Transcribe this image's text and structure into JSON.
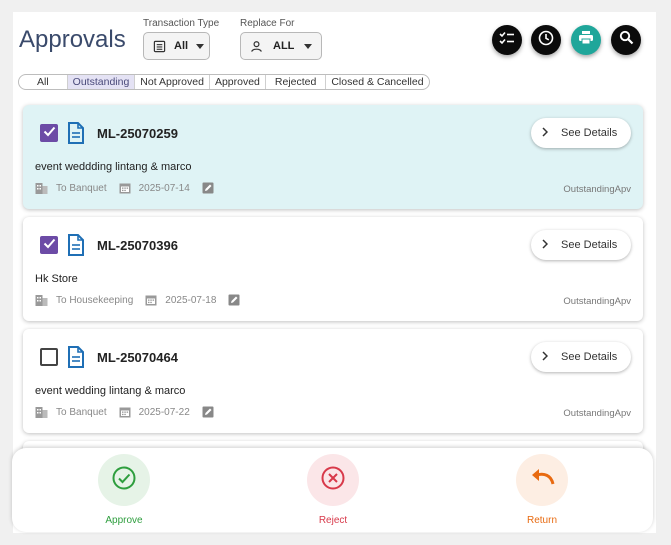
{
  "header": {
    "title": "Approvals",
    "transaction_type": {
      "label": "Transaction Type",
      "value": "All"
    },
    "replace_for": {
      "label": "Replace For",
      "value": "ALL"
    },
    "icon_buttons": [
      "checklist-icon",
      "clock-icon",
      "print-icon",
      "search-icon"
    ]
  },
  "tabs": [
    {
      "label": "All",
      "active": false
    },
    {
      "label": "Outstanding",
      "active": true
    },
    {
      "label": "Not Approved",
      "active": false
    },
    {
      "label": "Approved",
      "active": false
    },
    {
      "label": "Rejected",
      "active": false
    },
    {
      "label": "Closed & Cancelled",
      "active": false
    }
  ],
  "cards": [
    {
      "id": "ML-25070259",
      "checked": true,
      "selected": true,
      "details_label": "See Details",
      "description": "event weddding lintang & marco",
      "destination": "To Banquet",
      "date": "2025-07-14",
      "status": "OutstandingApv"
    },
    {
      "id": "ML-25070396",
      "checked": true,
      "selected": false,
      "details_label": "See Details",
      "description": "Hk Store",
      "destination": "To Housekeeping",
      "date": "2025-07-18",
      "status": "OutstandingApv"
    },
    {
      "id": "ML-25070464",
      "checked": false,
      "selected": false,
      "details_label": "See Details",
      "description": "event wedding lintang & marco",
      "destination": "To Banquet",
      "date": "2025-07-22",
      "status": "OutstandingApv"
    }
  ],
  "actions": {
    "approve": {
      "label": "Approve",
      "color": "#2e9e3e",
      "bg": "#e6f3e7"
    },
    "reject": {
      "label": "Reject",
      "color": "#d8394a",
      "bg": "#fbe6e8"
    },
    "return": {
      "label": "Return",
      "color": "#e86a10",
      "bg": "#fdeee3"
    }
  },
  "colors": {
    "accent_purple": "#6c4ba6",
    "doc_blue": "#1f6fb5",
    "teal": "#1fa69a",
    "selected_card": "#dff3f5"
  }
}
